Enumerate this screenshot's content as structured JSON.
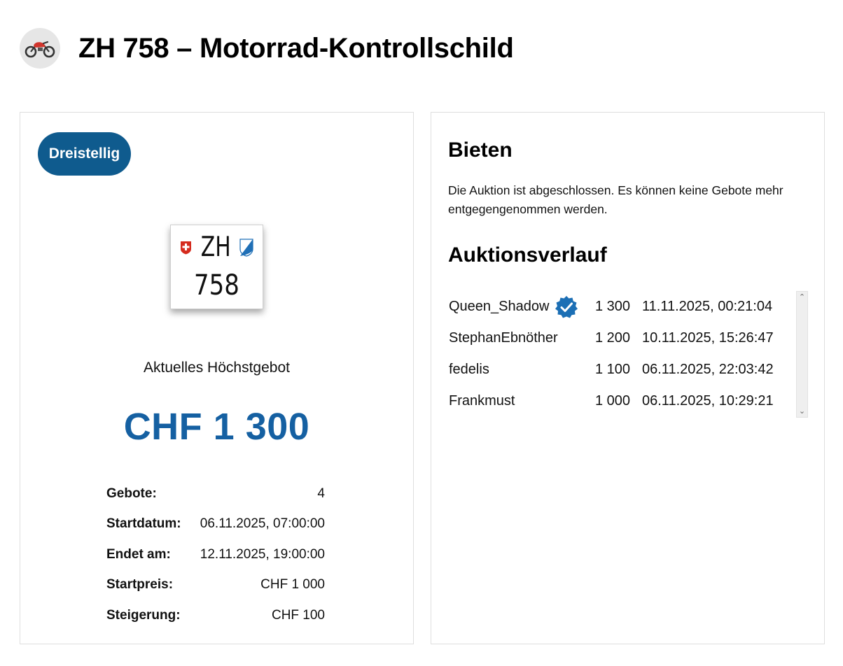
{
  "header": {
    "title": "ZH 758 – Motorrad-Kontrollschild",
    "logo_icon": "motorcycle-icon"
  },
  "listing": {
    "badge": "Dreistellig",
    "plate": {
      "canton": "ZH",
      "number": "758"
    },
    "current_bid_label": "Aktuelles Höchstgebot",
    "current_bid_value": "CHF 1 300",
    "details": [
      {
        "label": "Gebote:",
        "value": "4"
      },
      {
        "label": "Startdatum:",
        "value": "06.11.2025, 07:00:00"
      },
      {
        "label": "Endet am:",
        "value": "12.11.2025, 19:00:00"
      },
      {
        "label": "Startpreis:",
        "value": "CHF 1 000"
      },
      {
        "label": "Steigerung:",
        "value": "CHF 100"
      }
    ]
  },
  "bidding": {
    "title": "Bieten",
    "notice": "Die Auktion ist abgeschlossen. Es können keine Gebote mehr entgegengenommen werden.",
    "history_title": "Auktionsverlauf",
    "history": [
      {
        "user": "Queen_Shadow",
        "verified": true,
        "amount": "1 300",
        "time": "11.11.2025, 00:21:04"
      },
      {
        "user": "StephanEbnöther",
        "verified": false,
        "amount": "1 200",
        "time": "10.11.2025, 15:26:47"
      },
      {
        "user": "fedelis",
        "verified": false,
        "amount": "1 100",
        "time": "06.11.2025, 22:03:42"
      },
      {
        "user": "Frankmust",
        "verified": false,
        "amount": "1 000",
        "time": "06.11.2025, 10:29:21"
      }
    ]
  },
  "colors": {
    "accent": "#1560a2",
    "badge_bg": "#0f5b8e"
  }
}
